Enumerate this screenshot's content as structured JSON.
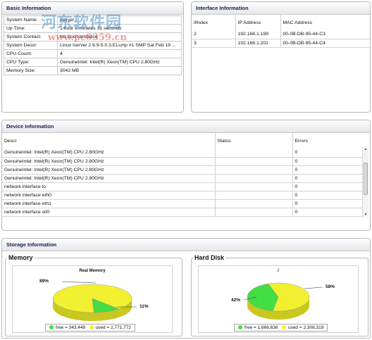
{
  "basic": {
    "title": "Basic Information",
    "rows": [
      {
        "key": "System Name:",
        "value": "lserver"
      },
      {
        "key": "Up Time:",
        "value": "1 hour 6 minutes 31 seconds"
      },
      {
        "key": "System Contact:",
        "value": "No Such Instance"
      },
      {
        "key": "System Descr:",
        "value": "Linux lserver 2.6.9-5.0.3.ELsmp #1 SMP Sat Feb 19 ..."
      },
      {
        "key": "CPU Count:",
        "value": "4"
      },
      {
        "key": "CPU Type:",
        "value": "GenuineIntel: Intel(R) Xeon(TM) CPU 2.80GHz"
      },
      {
        "key": "Memory Size:",
        "value": "3042 MB"
      }
    ]
  },
  "interface": {
    "title": "Interface Information",
    "columns": [
      "ifIndex",
      "IP Address",
      "MAC Address"
    ],
    "rows": [
      [
        "2",
        "192.168.1.199",
        "00-0B-DB-95-44-C3"
      ],
      [
        "3",
        "192.168.1.201",
        "00-0B-DB-95-44-C4"
      ]
    ]
  },
  "device": {
    "title": "Device Information",
    "columns": [
      "Descr",
      "Status",
      "Errors"
    ],
    "rows": [
      [
        "GenuineIntel: Intel(R) Xeon(TM) CPU 2.80GHz",
        "",
        "0"
      ],
      [
        "GenuineIntel: Intel(R) Xeon(TM) CPU 2.80GHz",
        "",
        "0"
      ],
      [
        "GenuineIntel: Intel(R) Xeon(TM) CPU 2.80GHz",
        "",
        "0"
      ],
      [
        "GenuineIntel: Intel(R) Xeon(TM) CPU 2.80GHz",
        "",
        "0"
      ],
      [
        "network interface lo",
        "",
        "0"
      ],
      [
        "network interface eth0",
        "",
        "0"
      ],
      [
        "network interface eth1",
        "",
        "0"
      ],
      [
        "network interface sit0",
        "",
        "0"
      ]
    ]
  },
  "storage": {
    "title": "Storage Information",
    "memory": {
      "group_label": "Memory",
      "chart_title": "Real Memory",
      "slices": [
        {
          "label": "free",
          "percent": 11,
          "value": "343,448",
          "color": "#44dd44"
        },
        {
          "label": "used",
          "percent": 89,
          "value": "2,771,772",
          "color": "#f0f030"
        }
      ],
      "pct_free": "11%",
      "pct_used": "89%",
      "legend_free": "free = 343,448",
      "legend_used": "used = 2,771,772"
    },
    "disk": {
      "group_label": "Hard Disk",
      "chart_title": "/",
      "slices": [
        {
          "label": "free",
          "percent": 42,
          "value": "1,666,636",
          "color": "#44dd44"
        },
        {
          "label": "used",
          "percent": 58,
          "value": "2,308,319",
          "color": "#f0f030"
        }
      ],
      "pct_free": "42%",
      "pct_used": "58%",
      "legend_free": "free = 1,666,636",
      "legend_used": "used = 2,308,319"
    }
  },
  "watermark": {
    "text": "河东软件园",
    "url": "www.pc0359.cn"
  },
  "colors": {
    "free": "#44dd44",
    "used": "#f0f030",
    "title_text": "#1a1a4a"
  }
}
